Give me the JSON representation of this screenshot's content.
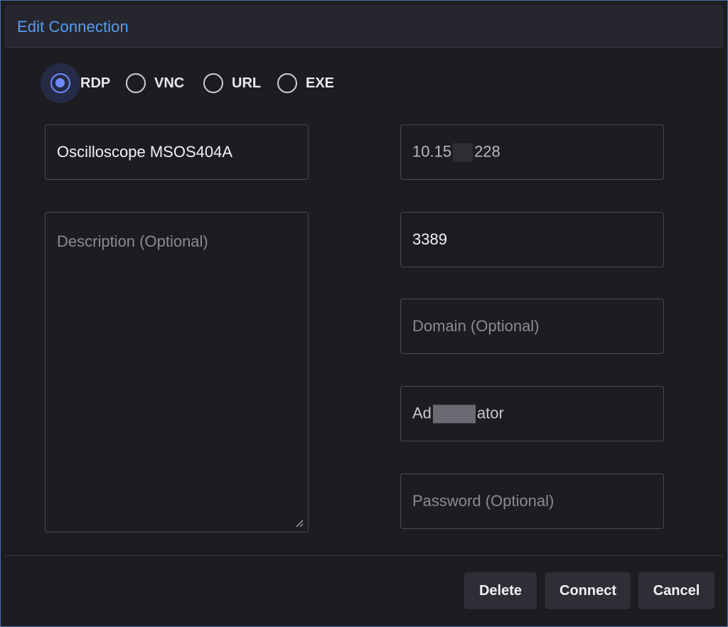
{
  "dialog": {
    "title": "Edit Connection"
  },
  "protocol": {
    "options": [
      "RDP",
      "VNC",
      "URL",
      "EXE"
    ],
    "selected": "RDP"
  },
  "form": {
    "name": {
      "value": "Oscilloscope MSOS404A"
    },
    "description": {
      "placeholder": "Description (Optional)",
      "value": ""
    },
    "host": {
      "value_prefix": "10.15",
      "value_suffix": "228"
    },
    "port": {
      "value": "3389"
    },
    "domain": {
      "placeholder": "Domain (Optional)",
      "value": ""
    },
    "username": {
      "value_prefix": "Ad",
      "value_suffix": "ator"
    },
    "password": {
      "placeholder": "Password (Optional)",
      "value": ""
    }
  },
  "buttons": {
    "delete": "Delete",
    "connect": "Connect",
    "cancel": "Cancel"
  },
  "colors": {
    "accent": "#6f8bff",
    "title": "#5b9bf0",
    "background": "#1c1c21",
    "button": "#2e2e36"
  }
}
